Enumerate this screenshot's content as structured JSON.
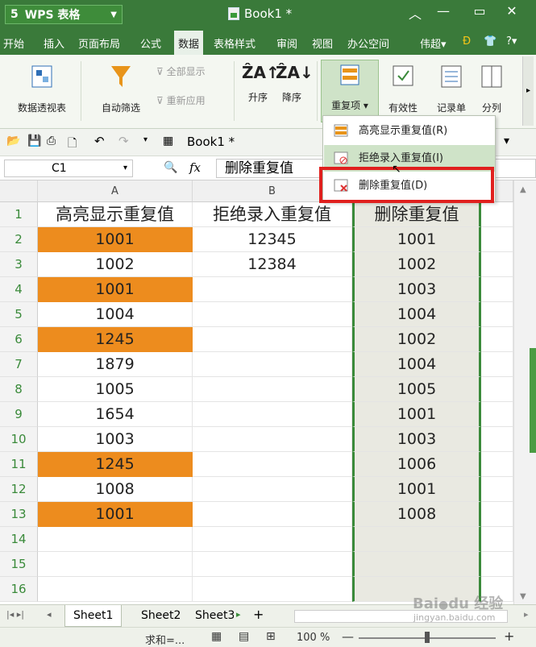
{
  "app": {
    "logo": "5",
    "name": "WPS 表格",
    "doc_title": "Book1 *"
  },
  "menu": [
    "开始",
    "插入",
    "页面布局",
    "公式",
    "数据",
    "表格样式",
    "审阅",
    "视图",
    "办公空间"
  ],
  "menu_right": {
    "user": "伟超",
    "help": "?"
  },
  "ribbon": {
    "pivot": "数据透视表",
    "autofilter": "自动筛选",
    "show_all": "全部显示",
    "reapply": "重新应用",
    "sort_asc": "升序",
    "sort_desc": "降序",
    "duplicates": "重复项",
    "validity": "有效性",
    "record": "记录单",
    "split": "分列"
  },
  "quickaccess": {
    "book": "Book1 *"
  },
  "formula": {
    "namebox": "C1",
    "fx": "fx",
    "value": "删除重复值"
  },
  "columns": [
    "A",
    "B"
  ],
  "rows": [
    {
      "n": "1",
      "a": "高亮显示重复值",
      "b": "拒绝录入重复值",
      "c": "删除重复值"
    },
    {
      "n": "2",
      "a": "1001",
      "b": "12345",
      "c": "1001"
    },
    {
      "n": "3",
      "a": "1002",
      "b": "12384",
      "c": "1002"
    },
    {
      "n": "4",
      "a": "1001",
      "b": "",
      "c": "1003"
    },
    {
      "n": "5",
      "a": "1004",
      "b": "",
      "c": "1004"
    },
    {
      "n": "6",
      "a": "1245",
      "b": "",
      "c": "1002"
    },
    {
      "n": "7",
      "a": "1879",
      "b": "",
      "c": "1004"
    },
    {
      "n": "8",
      "a": "1005",
      "b": "",
      "c": "1005"
    },
    {
      "n": "9",
      "a": "1654",
      "b": "",
      "c": "1001"
    },
    {
      "n": "10",
      "a": "1003",
      "b": "",
      "c": "1003"
    },
    {
      "n": "11",
      "a": "1245",
      "b": "",
      "c": "1006"
    },
    {
      "n": "12",
      "a": "1008",
      "b": "",
      "c": "1001"
    },
    {
      "n": "13",
      "a": "1001",
      "b": "",
      "c": "1008"
    },
    {
      "n": "14",
      "a": "",
      "b": "",
      "c": ""
    },
    {
      "n": "15",
      "a": "",
      "b": "",
      "c": ""
    },
    {
      "n": "16",
      "a": "",
      "b": "",
      "c": ""
    }
  ],
  "highlighted_rows": [
    "2",
    "4",
    "6",
    "11",
    "13"
  ],
  "dropdown": [
    {
      "label": "高亮显示重复值(R)"
    },
    {
      "label": "拒绝录入重复值(I)"
    },
    {
      "label": "删除重复值(D)"
    }
  ],
  "sheets": [
    "Sheet1",
    "Sheet2",
    "Sheet3"
  ],
  "status": {
    "sum": "求和=...",
    "zoom": "100 %"
  },
  "watermark": "Baidu 经验 jingyan.baidu.com",
  "colors": {
    "accent": "#3a7a3a",
    "highlight": "#ed8c1e",
    "red_box": "#e0201e"
  }
}
